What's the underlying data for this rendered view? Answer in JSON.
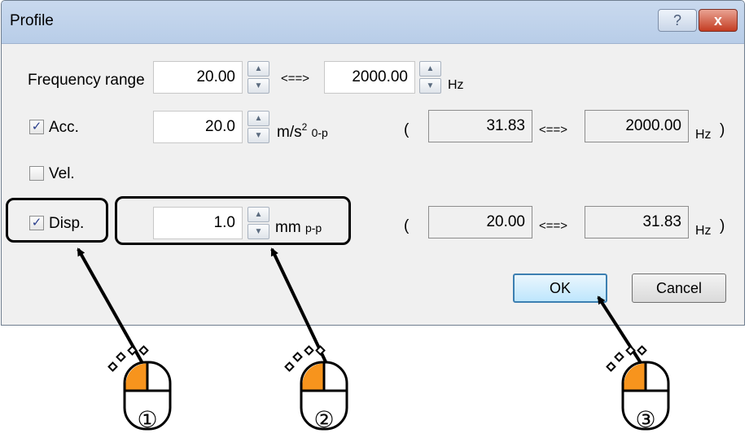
{
  "window": {
    "title": "Profile",
    "help_glyph": "?",
    "close_glyph": "x"
  },
  "freq": {
    "label": "Frequency range",
    "min": "20.00",
    "arrow": "<==>",
    "max": "2000.00",
    "unit": "Hz"
  },
  "acc": {
    "label": "Acc.",
    "checked": true,
    "value": "20.0",
    "unit_main": "m/s",
    "unit_sup": "2",
    "unit_sub": "0-p",
    "open_paren": "(",
    "range_min": "31.83",
    "arrow": "<==>",
    "range_max": "2000.00",
    "range_unit": "Hz",
    "close_paren": ")"
  },
  "vel": {
    "label": "Vel.",
    "checked": false
  },
  "disp": {
    "label": "Disp.",
    "checked": true,
    "value": "1.0",
    "unit_main": "mm",
    "unit_sub": "p-p",
    "open_paren": "(",
    "range_min": "20.00",
    "arrow": "<==>",
    "range_max": "31.83",
    "range_unit": "Hz",
    "close_paren": ")"
  },
  "buttons": {
    "ok": "OK",
    "cancel": "Cancel"
  },
  "checkmark": "✓",
  "spin": {
    "up": "▲",
    "down": "▼"
  },
  "callouts": [
    {
      "number": "①"
    },
    {
      "number": "②"
    },
    {
      "number": "③"
    }
  ],
  "colors": {
    "mouse_button": "#f7941d",
    "default_button": "#3c7fb1"
  }
}
